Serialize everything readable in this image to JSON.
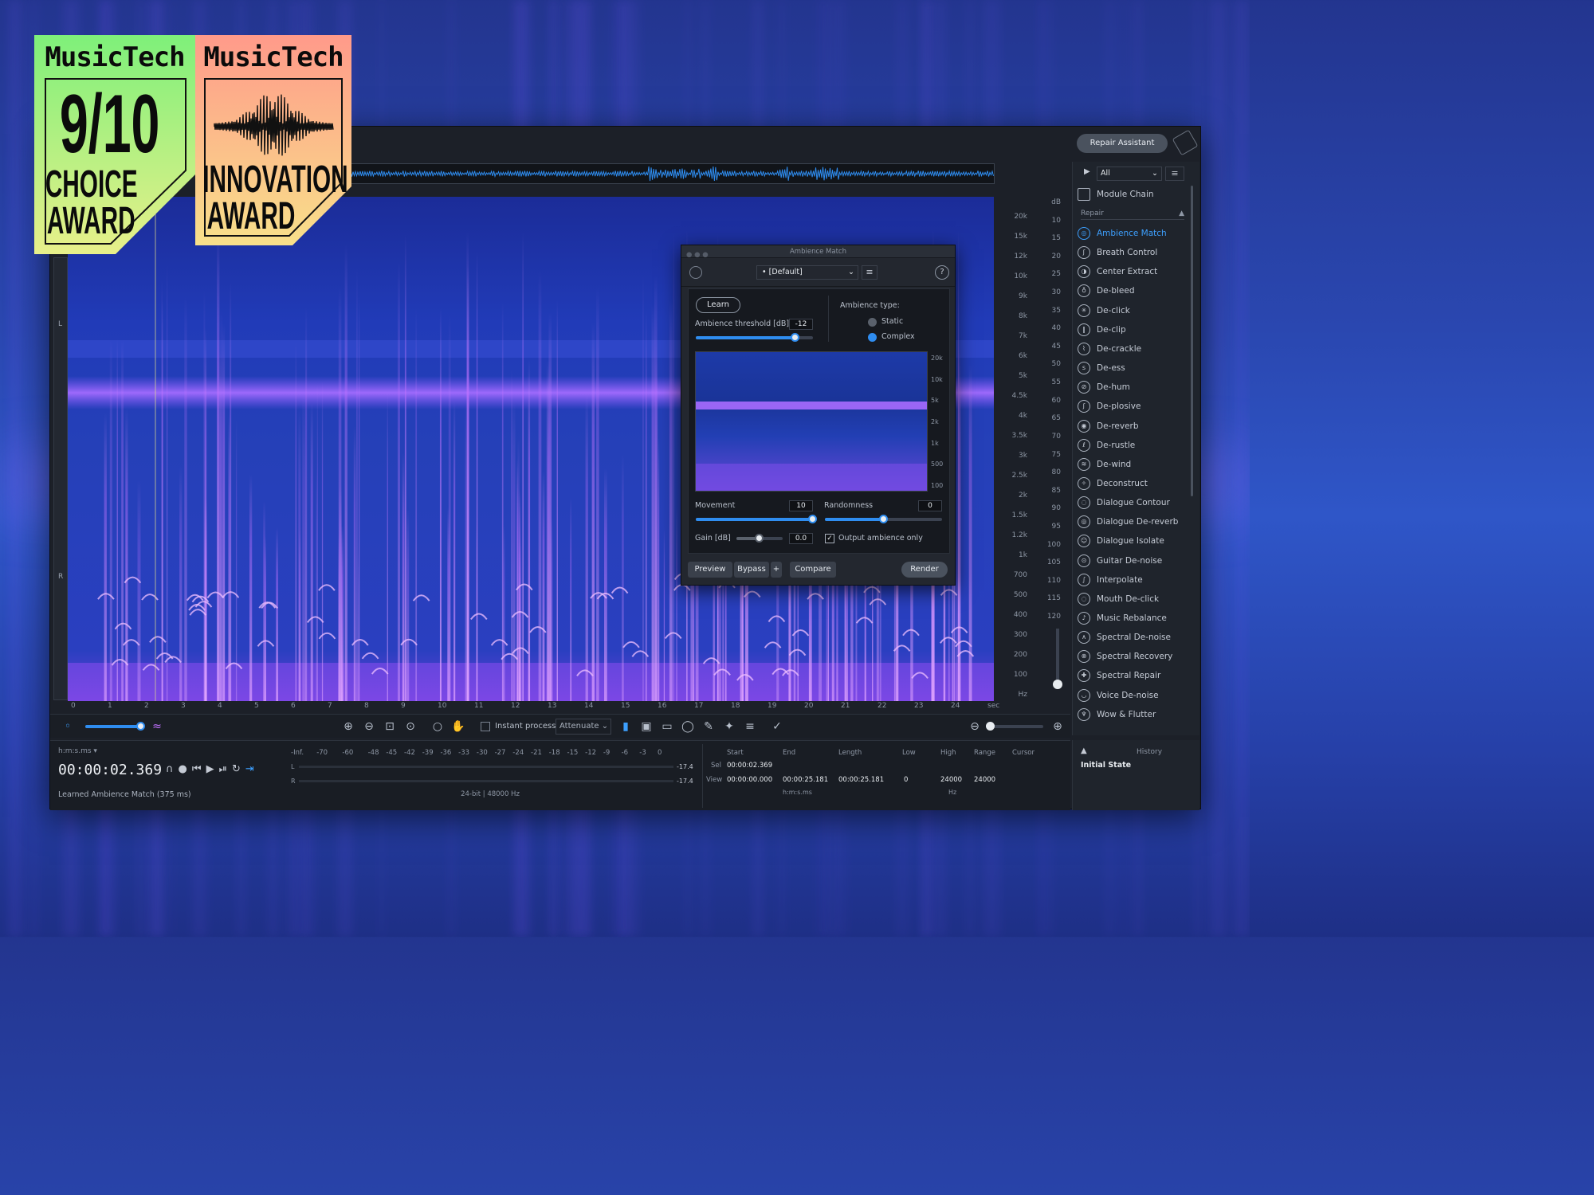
{
  "badges": {
    "left": {
      "brand": "MusicTech",
      "score": "9/10",
      "line1": "CHOICE",
      "line2": "AWARD"
    },
    "right": {
      "brand": "MusicTech",
      "line1": "INNOVATION",
      "line2": "AWARD"
    }
  },
  "header": {
    "repair_assistant": "Repair Assistant"
  },
  "channels": {
    "left": "L",
    "right": "R"
  },
  "freq_ticks": [
    "20k",
    "15k",
    "12k",
    "10k",
    "9k",
    "8k",
    "7k",
    "6k",
    "5k",
    "4.5k",
    "4k",
    "3.5k",
    "3k",
    "2.5k",
    "2k",
    "1.5k",
    "1.2k",
    "1k",
    "700",
    "500",
    "400",
    "300",
    "200",
    "100",
    "Hz"
  ],
  "db_ticks": [
    "dB",
    "10",
    "15",
    "20",
    "25",
    "30",
    "35",
    "40",
    "45",
    "50",
    "55",
    "60",
    "65",
    "70",
    "75",
    "80",
    "85",
    "90",
    "95",
    "100",
    "105",
    "110",
    "115",
    "120"
  ],
  "time_ticks": [
    "0",
    "1",
    "2",
    "3",
    "4",
    "5",
    "6",
    "7",
    "8",
    "9",
    "10",
    "11",
    "12",
    "13",
    "14",
    "15",
    "16",
    "17",
    "18",
    "19",
    "20",
    "21",
    "22",
    "23",
    "24",
    "sec"
  ],
  "toolbar": {
    "instant_process": "Instant process",
    "mode": "Attenuate"
  },
  "transport": {
    "format_label": "h:m:s.ms",
    "time": "00:00:02.369",
    "status": "Learned Ambience Match (375 ms)"
  },
  "meter": {
    "scale": [
      "-Inf.",
      "-70",
      "-60",
      "-48",
      "-45",
      "-42",
      "-39",
      "-36",
      "-33",
      "-30",
      "-27",
      "-24",
      "-21",
      "-18",
      "-15",
      "-12",
      "-9",
      "-6",
      "-3",
      "0"
    ],
    "l_label": "L",
    "r_label": "R",
    "l_peak": "-17.4",
    "r_peak": "-17.4",
    "format": "24-bit | 48000 Hz"
  },
  "selection": {
    "headers": [
      "Start",
      "End",
      "Length",
      "Low",
      "High",
      "Range",
      "Cursor"
    ],
    "sel_label": "Sel",
    "view_label": "View",
    "sel_start": "00:00:02.369",
    "view_start": "00:00:00.000",
    "view_end": "00:00:25.181",
    "view_length": "00:00:25.181",
    "low": "0",
    "high": "24000",
    "range": "24000",
    "time_unit": "h:m:s.ms",
    "freq_unit": "Hz"
  },
  "sidebar": {
    "filter": "All",
    "module_chain": "Module Chain",
    "section": "Repair",
    "items": [
      "Ambience Match",
      "Breath Control",
      "Center Extract",
      "De-bleed",
      "De-click",
      "De-clip",
      "De-crackle",
      "De-ess",
      "De-hum",
      "De-plosive",
      "De-reverb",
      "De-rustle",
      "De-wind",
      "Deconstruct",
      "Dialogue Contour",
      "Dialogue De-reverb",
      "Dialogue Isolate",
      "Guitar De-noise",
      "Interpolate",
      "Mouth De-click",
      "Music Rebalance",
      "Spectral De-noise",
      "Spectral Recovery",
      "Spectral Repair",
      "Voice De-noise",
      "Wow & Flutter"
    ],
    "active_index": 0
  },
  "history": {
    "title": "History",
    "entry": "Initial State"
  },
  "dialog": {
    "title": "Ambience Match",
    "preset": "[Default]",
    "learn": "Learn",
    "threshold_label": "Ambience threshold [dB]",
    "threshold_value": "-12",
    "threshold_fraction": 0.85,
    "type_label": "Ambience type:",
    "type_static": "Static",
    "type_complex": "Complex",
    "selected_type": "Complex",
    "spec_ticks": [
      "20k",
      "10k",
      "5k",
      "2k",
      "1k",
      "500",
      "100"
    ],
    "movement_label": "Movement",
    "movement_value": "10",
    "movement_fraction": 1.0,
    "randomness_label": "Randomness",
    "randomness_value": "0",
    "randomness_fraction": 0.5,
    "gain_label": "Gain [dB]",
    "gain_value": "0.0",
    "gain_fraction": 0.5,
    "output_only": "Output ambience only",
    "preview": "Preview",
    "bypass": "Bypass",
    "plus": "+",
    "compare": "Compare",
    "render": "Render"
  },
  "colors": {
    "accent": "#2f8df0",
    "spectrum_base": "#1b2fa8",
    "spectrum_hot": "#c070ff",
    "badge_left": "#9df07a",
    "badge_right": "#f7b08a"
  }
}
